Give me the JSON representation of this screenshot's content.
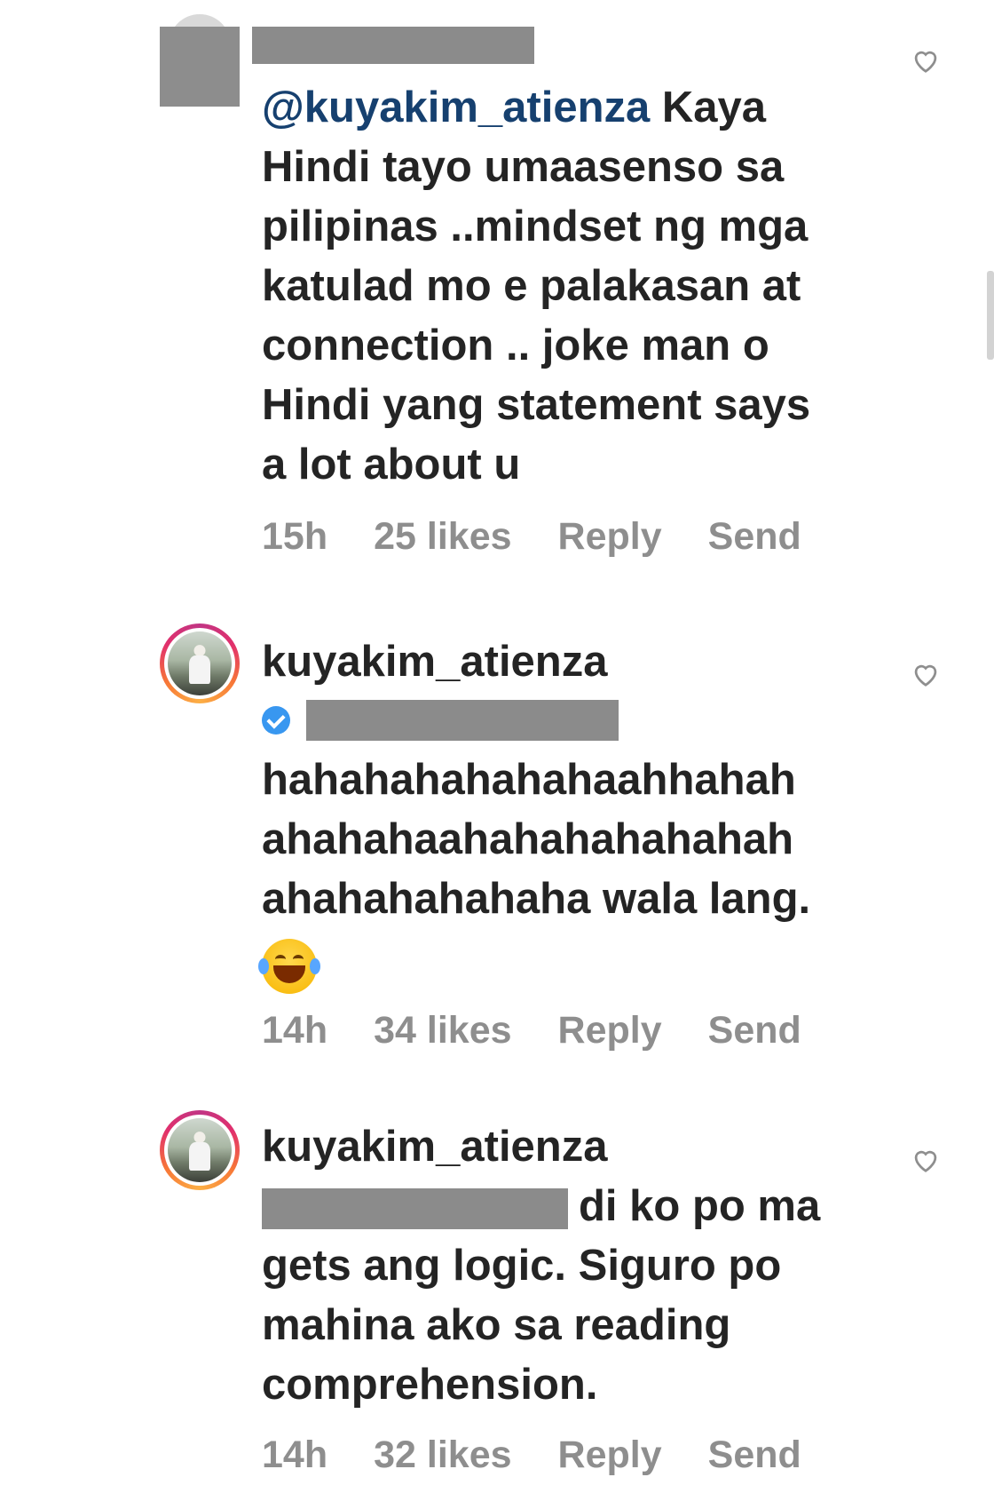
{
  "comments": [
    {
      "avatar": "redacted-avatar",
      "mention": "@kuyakim_atienza",
      "lines": [
        "Kaya",
        "Hindi tayo umaasenso sa",
        "pilipinas ..mindset ng mga",
        "katulad mo e palakasan at",
        "connection .. joke man o",
        "Hindi yang statement says",
        "a lot about u"
      ],
      "time": "15h",
      "likes": "25 likes",
      "reply": "Reply",
      "send": "Send"
    },
    {
      "avatar": "story-avatar",
      "username": "kuyakim_atienza",
      "lines": [
        "hahahahahahahaahhahah",
        "ahahahaahahahahahahah",
        "ahahahahahaha wala lang."
      ],
      "emoji": "face-with-tears-of-joy-icon",
      "time": "14h",
      "likes": "34 likes",
      "reply": "Reply",
      "send": "Send"
    },
    {
      "avatar": "story-avatar",
      "username": "kuyakim_atienza",
      "first_line": "di ko po ma",
      "lines": [
        "gets ang logic. Siguro po",
        "mahina ako sa reading",
        "comprehension."
      ],
      "time": "14h",
      "likes": "32 likes",
      "reply": "Reply",
      "send": "Send"
    }
  ],
  "icons": {
    "like": "heart-outline-icon",
    "verified": "verified-badge-icon"
  },
  "colors": {
    "mention": "#16406f",
    "meta": "#8e8e8e",
    "verified": "#3897f0",
    "redaction": "#8b8b8b"
  }
}
